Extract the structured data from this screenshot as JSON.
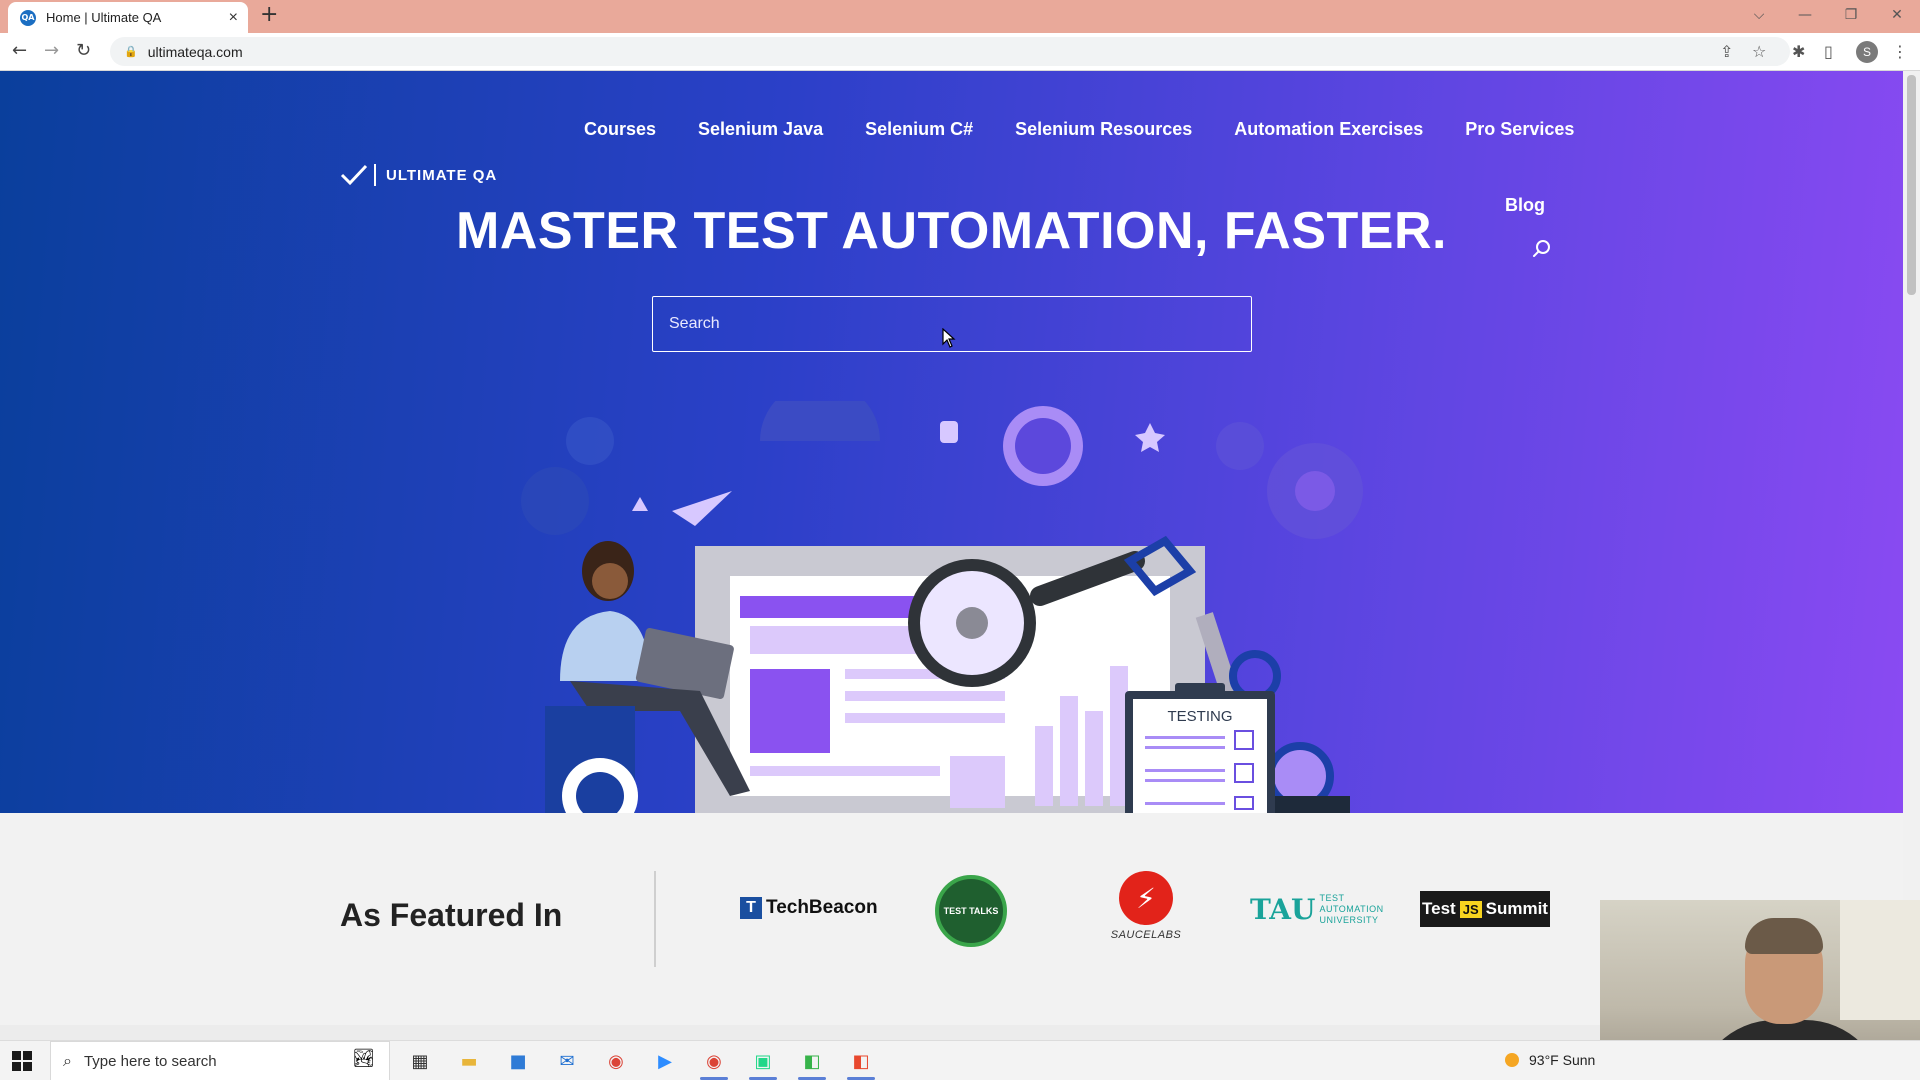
{
  "browser": {
    "tab": {
      "favicon": "QA",
      "title": "Home | Ultimate QA",
      "close_icon": "×"
    },
    "new_tab": "+",
    "window_controls": {
      "collapse": "⌵",
      "minimize": "—",
      "restore": "❐",
      "close": "✕"
    },
    "nav": {
      "back": "←",
      "forward": "→",
      "reload": "↻"
    },
    "url": "ultimateqa.com",
    "toolbar_icons": {
      "share": "⇪",
      "bookmark": "☆",
      "extensions": "✱",
      "sidebar": "▯",
      "menu": "⋮"
    },
    "profile_initial": "S"
  },
  "site": {
    "logo_text": "ULTIMATE QA",
    "nav": [
      "Courses",
      "Selenium Java",
      "Selenium C#",
      "Selenium Resources",
      "Automation Exercises",
      "Pro Services"
    ],
    "blog_link": "Blog",
    "headline": "MASTER TEST AUTOMATION, FASTER.",
    "search_placeholder": "Search",
    "illustration_label": "TESTING",
    "featured": {
      "title": "As Featured In",
      "brands": {
        "techbeacon": "TechBeacon",
        "techbeacon_mark": "T",
        "testtalks": "TEST TALKS",
        "saucelabs_mark": "⚡",
        "saucelabs": "SAUCELABS",
        "tau_mark": "TAU",
        "tau_text_1": "TEST",
        "tau_text_2": "AUTOMATION",
        "tau_text_3": "UNIVERSITY",
        "tjs_pre": "Test",
        "tjs_js": "JS",
        "tjs_post": "Summit"
      }
    }
  },
  "taskbar": {
    "search_placeholder": "Type here to search",
    "search_icon": "⌕",
    "apps": [
      {
        "name": "task-view",
        "glyph": "▦",
        "color": "#333333",
        "active": false
      },
      {
        "name": "file-explorer",
        "glyph": "▬",
        "color": "#e8b53a",
        "active": false
      },
      {
        "name": "store",
        "glyph": "■",
        "color": "#2f7bd6",
        "active": false
      },
      {
        "name": "mail",
        "glyph": "✉",
        "color": "#1f6fd1",
        "active": false
      },
      {
        "name": "chrome",
        "glyph": "◉",
        "color": "#db4437",
        "active": false
      },
      {
        "name": "zoom",
        "glyph": "▶",
        "color": "#2d8cff",
        "active": false
      },
      {
        "name": "chrome-profile",
        "glyph": "◉",
        "color": "#db4437",
        "active": true
      },
      {
        "name": "pycharm",
        "glyph": "▣",
        "color": "#21d789",
        "active": true
      },
      {
        "name": "camtasia-green",
        "glyph": "◧",
        "color": "#37b34a",
        "active": true
      },
      {
        "name": "camtasia",
        "glyph": "◧",
        "color": "#e8482e",
        "active": true
      }
    ],
    "weather": "93°F  Sunn"
  }
}
